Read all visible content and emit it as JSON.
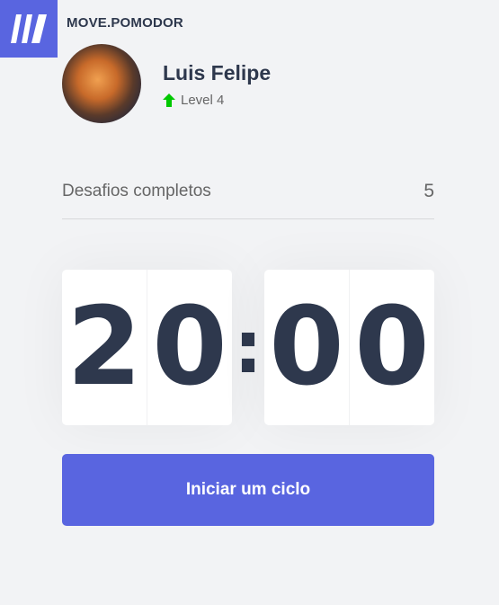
{
  "app": {
    "title": "MOVE.POMODOR"
  },
  "profile": {
    "name": "Luis Felipe",
    "level": "Level 4",
    "level_icon": "arrow-up-icon",
    "level_color": "#00c800"
  },
  "challenges": {
    "label": "Desafios completos",
    "count": "5"
  },
  "countdown": {
    "minute_left": "2",
    "minute_right": "0",
    "separator": ":",
    "second_left": "0",
    "second_right": "0"
  },
  "actions": {
    "start_label": "Iniciar um ciclo"
  },
  "colors": {
    "brand": "#5965e0",
    "text": "#2e384d",
    "muted": "#666666",
    "background": "#f2f3f5"
  }
}
